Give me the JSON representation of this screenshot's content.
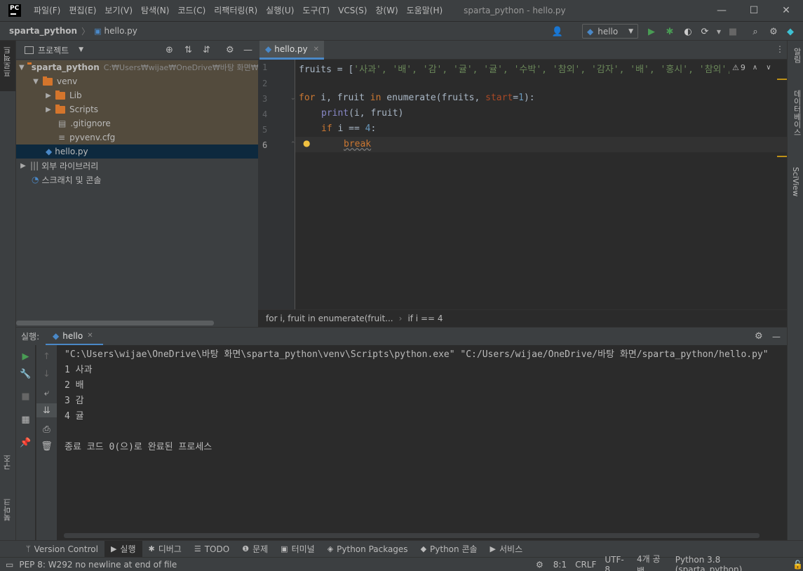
{
  "window": {
    "title": "sparta_python - hello.py",
    "logo_text": "PC",
    "controls": {
      "minimize": "—",
      "maximize": "☐",
      "close": "✕"
    }
  },
  "menu": [
    "파일(F)",
    "편집(E)",
    "보기(V)",
    "탐색(N)",
    "코드(C)",
    "리팩터링(R)",
    "실행(U)",
    "도구(T)",
    "VCS(S)",
    "창(W)",
    "도움말(H)"
  ],
  "nav": {
    "project": "sparta_python",
    "file": "hello.py",
    "run_config": "hello"
  },
  "project_panel": {
    "title": "프로젝트",
    "root_name": "sparta_python",
    "root_path": "C:₩Users₩wijae₩OneDrive₩바탕 화면₩s",
    "venv": "venv",
    "lib": "Lib",
    "scripts": "Scripts",
    "gitignore": ".gitignore",
    "pyvenv": "pyvenv.cfg",
    "hello": "hello.py",
    "external": "외부 라이브러리",
    "scratches": "스크래치 및 콘솔"
  },
  "left_strip": {
    "project": "프로젝트",
    "structure": "구조",
    "bookmarks": "북마크"
  },
  "right_strip": {
    "notifications": "알림",
    "database": "데이터베이스",
    "sciview": "SciView"
  },
  "editor": {
    "tab": "hello.py",
    "warnings": "9",
    "line_numbers": [
      "1",
      "2",
      "3",
      "4",
      "5",
      "6"
    ],
    "lines": {
      "l1_var": "fruits",
      "l1_op": " = [",
      "l1_items": "'사과', '배', '감', '귤', '귤', '수박', '참외', '감자', '배', '홍시', '참외', '오렌",
      "l3_for": "for",
      "l3_a": " i, fruit ",
      "l3_in": "in",
      "l3_b": " enumerate(fruits, ",
      "l3_param": "start",
      "l3_eq": "=",
      "l3_num": "1",
      "l3_c": "):",
      "l4_print": "print",
      "l4_rest": "(i, fruit)",
      "l5_if": "if",
      "l5_rest": " i == ",
      "l5_num": "4",
      "l5_colon": ":",
      "l6_break": "break"
    },
    "breadcrumbs": [
      "for i, fruit in enumerate(fruit...",
      "if i == 4"
    ]
  },
  "run": {
    "label": "실행:",
    "tab": "hello",
    "console": [
      "\"C:\\Users\\wijae\\OneDrive\\바탕 화면\\sparta_python\\venv\\Scripts\\python.exe\" \"C:/Users/wijae/OneDrive/바탕 화면/sparta_python/hello.py\"",
      "1 사과",
      "2 배",
      "3 감",
      "4 귤",
      "",
      "종료 코드 0(으)로 완료된 프로세스"
    ]
  },
  "bottom_tools": [
    "Version Control",
    "실행",
    "디버그",
    "TODO",
    "문제",
    "터미널",
    "Python Packages",
    "Python 콘솔",
    "서비스"
  ],
  "status": {
    "message": "PEP 8: W292 no newline at end of file",
    "position": "8:1",
    "line_sep": "CRLF",
    "encoding": "UTF-8",
    "indent": "4개 공백",
    "interpreter": "Python 3.8 (sparta_python)"
  },
  "colors": {
    "accent": "#4a88c7",
    "keyword": "#cc7832",
    "string": "#6a8759",
    "number": "#6897bb",
    "folder": "#d4752c",
    "run_green": "#499c54"
  }
}
